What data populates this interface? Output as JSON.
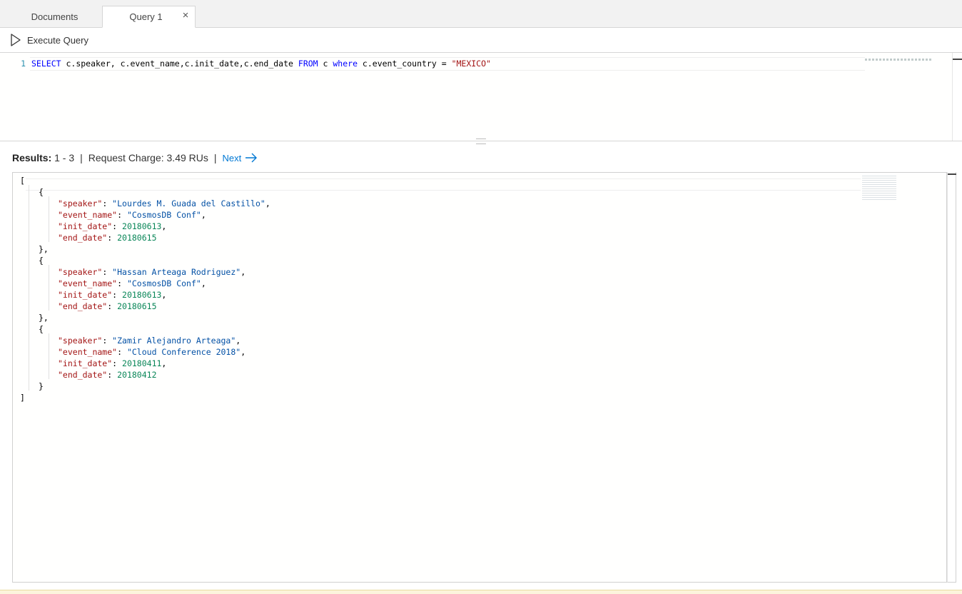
{
  "tabs": [
    {
      "label": "Documents"
    },
    {
      "label": "Query 1",
      "close": "×"
    }
  ],
  "toolbar": {
    "execute_label": "Execute Query"
  },
  "editor": {
    "line_number": "1",
    "query_parts": {
      "select": "SELECT",
      "fields": " c.speaker, c.event_name,c.init_date,c.end_date ",
      "from": "FROM",
      "alias": " c ",
      "where": "where",
      "condition": " c.event_country = ",
      "value": "\"MEXICO\""
    }
  },
  "results_bar": {
    "results_label": "Results:",
    "range": " 1 - 3",
    "separator": "|",
    "request_charge": "Request Charge: 3.49 RUs",
    "next_label": "Next"
  },
  "results": [
    {
      "speaker": "\"Lourdes M. Guada del Castillo\"",
      "event_name": "\"CosmosDB Conf\"",
      "init_date": "20180613",
      "end_date": "20180615"
    },
    {
      "speaker": "\"Hassan Arteaga Rodriguez\"",
      "event_name": "\"CosmosDB Conf\"",
      "init_date": "20180613",
      "end_date": "20180615"
    },
    {
      "speaker": "\"Zamir Alejandro Arteaga\"",
      "event_name": "\"Cloud Conference 2018\"",
      "init_date": "20180411",
      "end_date": "20180412"
    }
  ],
  "json_keys": {
    "speaker": "\"speaker\"",
    "event_name": "\"event_name\"",
    "init_date": "\"init_date\"",
    "end_date": "\"end_date\""
  },
  "json_punct": {
    "open_bracket": "[",
    "close_bracket": "]",
    "open_brace": "{",
    "close_brace_comma": "},",
    "close_brace": "}"
  }
}
